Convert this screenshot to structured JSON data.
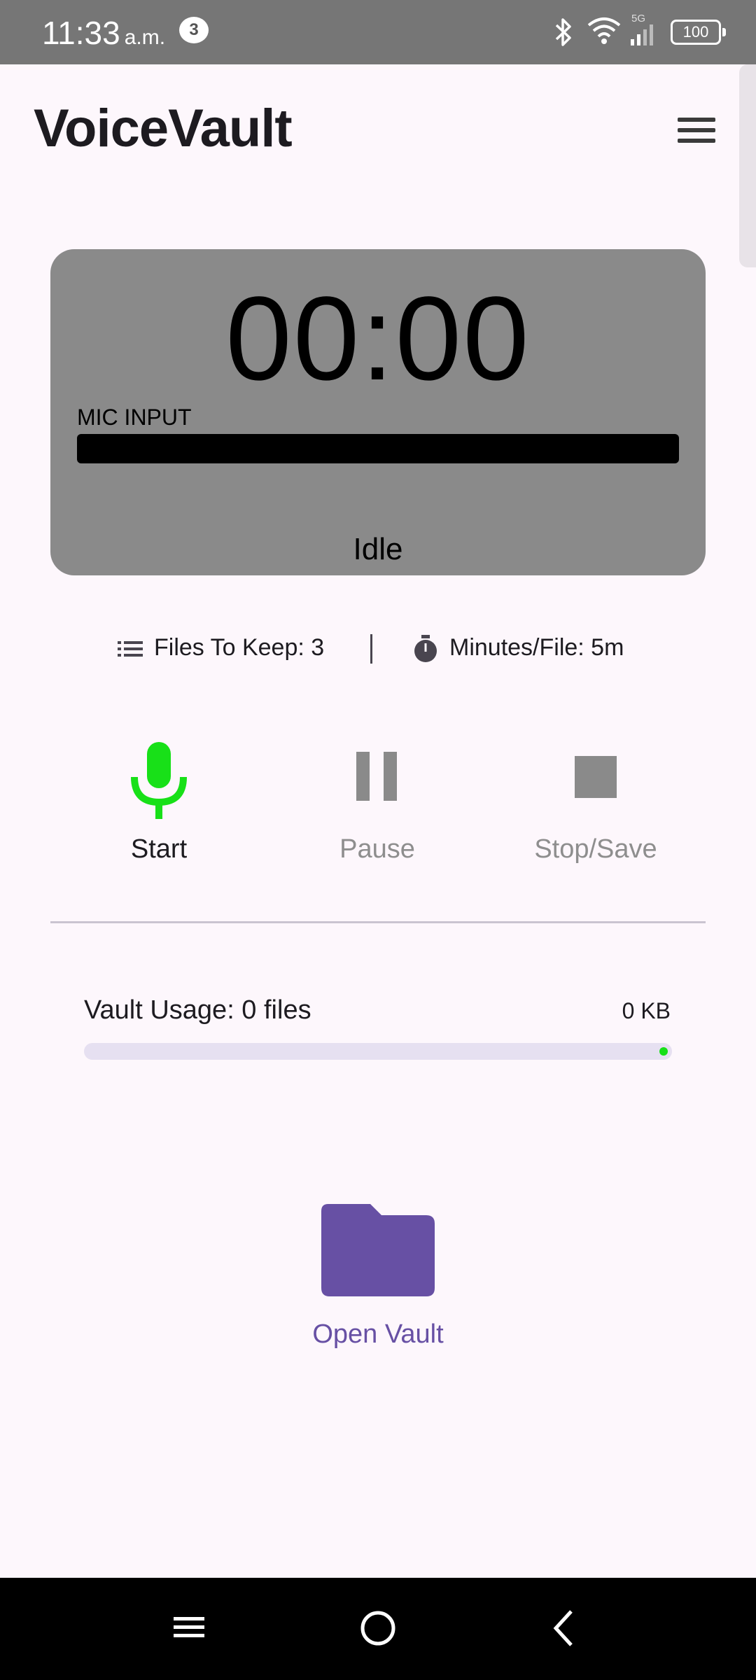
{
  "status_bar": {
    "time": "11:33",
    "ampm": "a.m.",
    "notification_count": "3",
    "network": "5G",
    "battery": "100"
  },
  "header": {
    "title": "VoiceVault",
    "menu_icon": "hamburger-menu-icon"
  },
  "recorder": {
    "timer": "00:00",
    "mic_label": "MIC INPUT",
    "mic_level": 0,
    "status": "Idle"
  },
  "settings": {
    "files_to_keep": "Files To Keep: 3",
    "minutes_per_file": "Minutes/File: 5m"
  },
  "controls": {
    "start": {
      "label": "Start",
      "icon": "microphone-icon",
      "enabled": true
    },
    "pause": {
      "label": "Pause",
      "icon": "pause-icon",
      "enabled": false
    },
    "stop": {
      "label": "Stop/Save",
      "icon": "stop-icon",
      "enabled": false
    }
  },
  "vault_usage": {
    "label": "Vault Usage: 0 files",
    "size": "0 KB",
    "fraction": 0
  },
  "open_vault": {
    "label": "Open Vault",
    "icon": "folder-icon"
  },
  "colors": {
    "accent": "#6750a4",
    "mic_green": "#18e018",
    "card_gray": "#8a8a8a",
    "disabled_gray": "#8e8e8e"
  }
}
